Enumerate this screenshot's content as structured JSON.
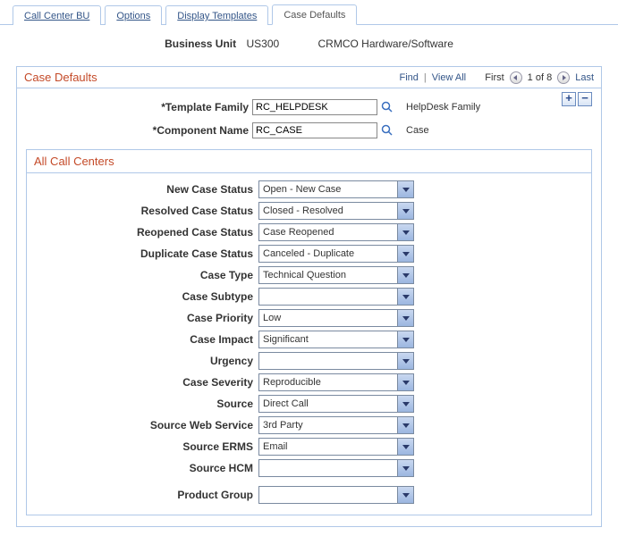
{
  "tabs": {
    "items": [
      {
        "label": "Call Center BU",
        "active": false
      },
      {
        "label": "Options",
        "active": false
      },
      {
        "label": "Display Templates",
        "active": false
      },
      {
        "label": "Case Defaults",
        "active": true
      }
    ]
  },
  "business_unit": {
    "label": "Business Unit",
    "code": "US300",
    "name": "CRMCO Hardware/Software"
  },
  "section": {
    "title": "Case Defaults",
    "find": "Find",
    "view_all": "View All",
    "first": "First",
    "counter": "1 of 8",
    "last": "Last"
  },
  "add_btn": "+",
  "remove_btn": "−",
  "template_family": {
    "label": "Template Family",
    "value": "RC_HELPDESK",
    "desc": "HelpDesk Family"
  },
  "component_name": {
    "label": "Component Name",
    "value": "RC_CASE",
    "desc": "Case"
  },
  "all_call_centers": {
    "title": "All Call Centers",
    "fields": [
      {
        "label": "New Case Status",
        "value": "Open - New Case"
      },
      {
        "label": "Resolved Case Status",
        "value": "Closed - Resolved"
      },
      {
        "label": "Reopened Case Status",
        "value": "Case Reopened"
      },
      {
        "label": "Duplicate Case Status",
        "value": "Canceled - Duplicate"
      },
      {
        "label": "Case Type",
        "value": "Technical Question"
      },
      {
        "label": "Case Subtype",
        "value": ""
      },
      {
        "label": "Case Priority",
        "value": "Low"
      },
      {
        "label": "Case Impact",
        "value": "Significant"
      },
      {
        "label": "Urgency",
        "value": ""
      },
      {
        "label": "Case Severity",
        "value": "Reproducible"
      },
      {
        "label": "Source",
        "value": "Direct Call"
      },
      {
        "label": "Source Web Service",
        "value": "3rd Party"
      },
      {
        "label": "Source ERMS",
        "value": "Email"
      },
      {
        "label": "Source HCM",
        "value": ""
      },
      {
        "label": "Product Group",
        "value": ""
      }
    ]
  }
}
